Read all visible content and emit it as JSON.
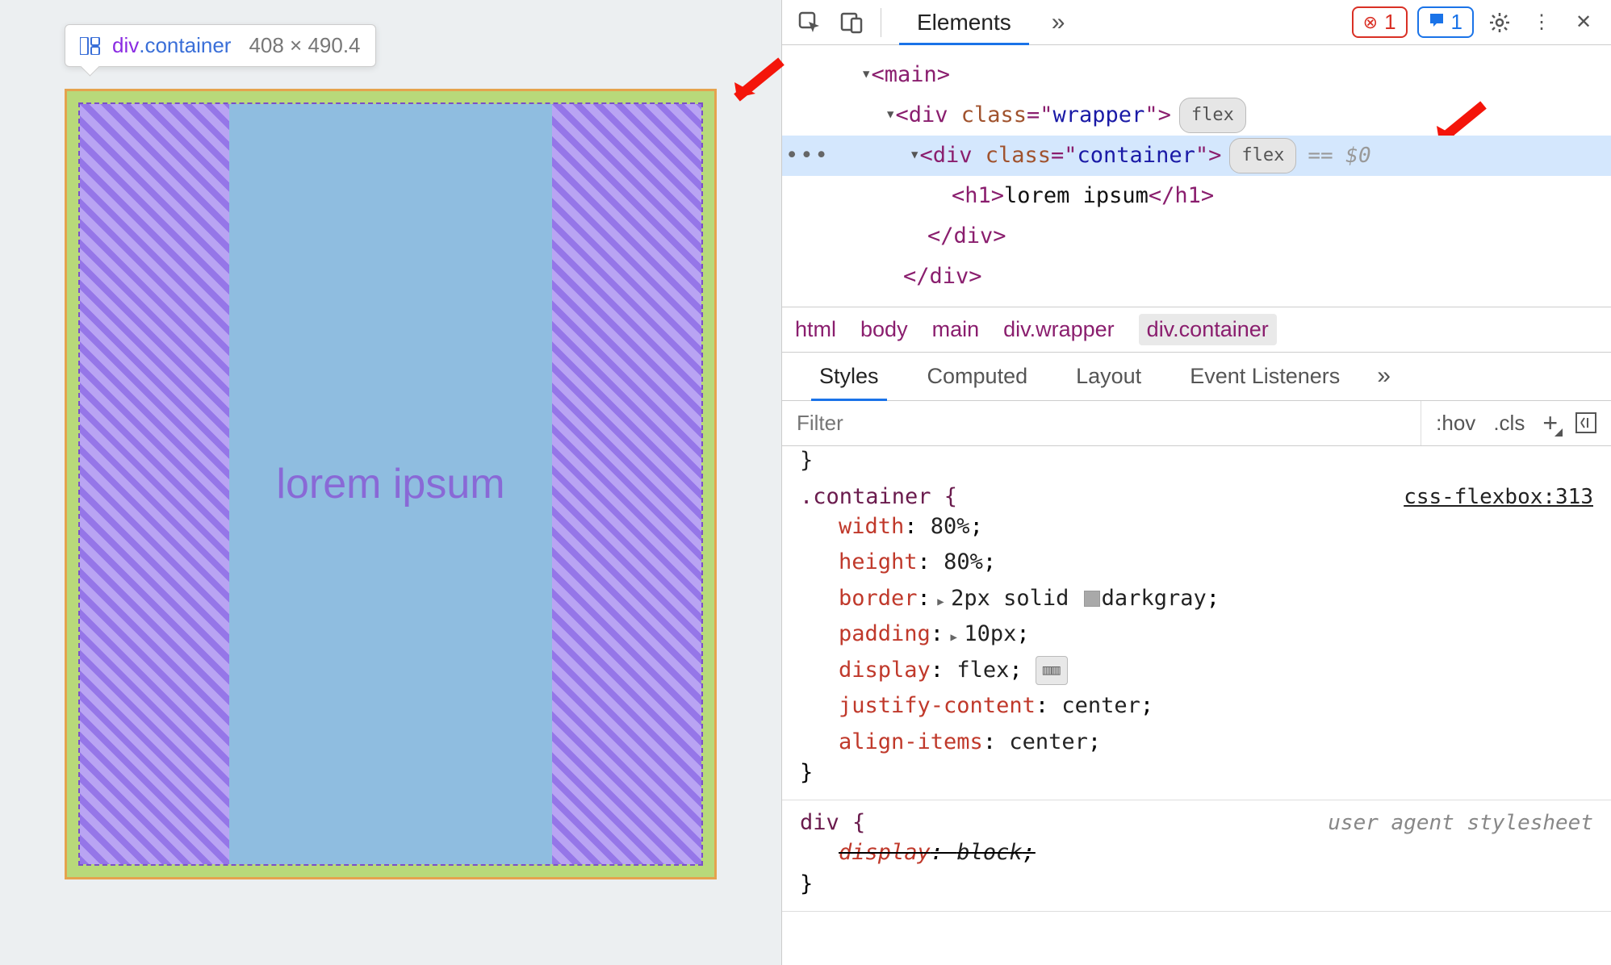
{
  "tooltip": {
    "tag": "div",
    "cls": ".container",
    "dims": "408 × 490.4"
  },
  "preview": {
    "heading": "lorem ipsum"
  },
  "toolbar": {
    "tabs": {
      "elements": "Elements"
    },
    "err_count": "1",
    "msg_count": "1"
  },
  "dom": {
    "main_open": "<main>",
    "wrapper_open": "<div class=\"wrapper\">",
    "container_open": "<div class=\"container\">",
    "flex_badge": "flex",
    "eqzero": "== $0",
    "h1": "<h1>lorem ipsum</h1>",
    "div_close": "</div>",
    "div_close2": "</div>"
  },
  "crumbs": [
    "html",
    "body",
    "main",
    "div.wrapper",
    "div.container"
  ],
  "subtabs": {
    "styles": "Styles",
    "computed": "Computed",
    "layout": "Layout",
    "listeners": "Event Listeners"
  },
  "filter": {
    "placeholder": "Filter",
    "hov": ":hov",
    "cls": ".cls"
  },
  "css": {
    "rule1": {
      "selector": ".container {",
      "source": "css-flexbox:313",
      "decls": [
        {
          "prop": "width",
          "val": "80%"
        },
        {
          "prop": "height",
          "val": "80%"
        },
        {
          "prop": "border",
          "val": "2px solid ",
          "swatch": true,
          "valAfter": "darkgray",
          "expand": true
        },
        {
          "prop": "padding",
          "val": "10px",
          "expand": true
        },
        {
          "prop": "display",
          "val": "flex",
          "flexicon": true
        },
        {
          "prop": "justify-content",
          "val": "center"
        },
        {
          "prop": "align-items",
          "val": "center"
        }
      ],
      "close": "}"
    },
    "rule2": {
      "selector": "div {",
      "source": "user agent stylesheet",
      "decl": {
        "prop": "display",
        "val": "block"
      },
      "close": "}"
    }
  }
}
